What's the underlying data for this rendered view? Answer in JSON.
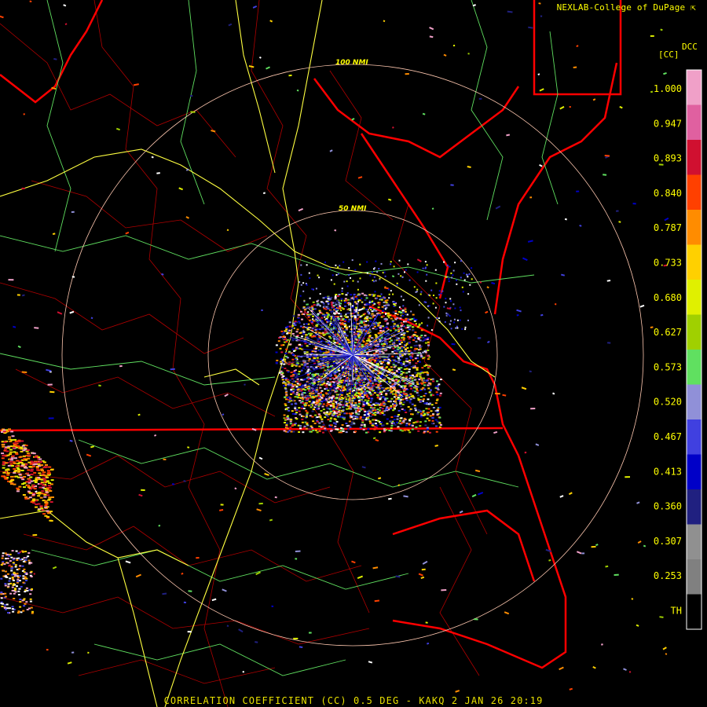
{
  "credit": "NEXLAB-College of DuPage",
  "footer": "CORRELATION COEFFICIENT (CC) 0.5 DEG - KAKQ 2 JAN 26 20:19",
  "legend": {
    "product": "DCC",
    "unit": "[CC]",
    "labels": [
      "1.000",
      "0.947",
      "0.893",
      "0.840",
      "0.787",
      "0.733",
      "0.680",
      "0.627",
      "0.573",
      "0.520",
      "0.467",
      "0.413",
      "0.360",
      "0.307",
      "0.253",
      "TH"
    ],
    "colors": [
      "#f0a0c8",
      "#e060a0",
      "#d01030",
      "#ff4000",
      "#ff8c00",
      "#ffd000",
      "#e0f000",
      "#a0d000",
      "#60e060",
      "#9090d8",
      "#4040e0",
      "#0000c8",
      "#202080",
      "#909090",
      "#808080",
      "#000000"
    ]
  },
  "range_rings": [
    {
      "label": "100 NMI"
    },
    {
      "label": "50 NMI"
    }
  ],
  "map_colors": {
    "state_lines": "#ff0000",
    "county_lines": "#cc0000",
    "highways": "#ffff40",
    "roads": "#60e060",
    "rings": "#ffc8b0"
  }
}
